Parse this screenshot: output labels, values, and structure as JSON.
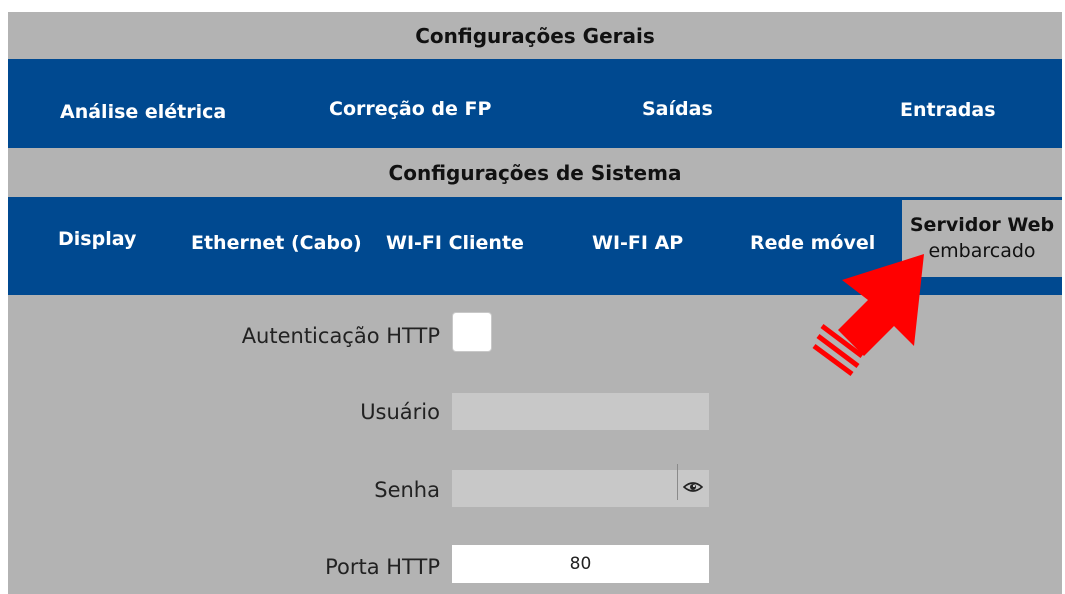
{
  "general": {
    "title": "Configurações Gerais",
    "tabs": [
      {
        "label": "Análise elétrica"
      },
      {
        "label": "Correção de FP"
      },
      {
        "label": "Saídas"
      },
      {
        "label": "Entradas"
      }
    ]
  },
  "system": {
    "title": "Configurações de Sistema",
    "tabs": [
      {
        "label": "Display"
      },
      {
        "label": "Ethernet (Cabo)"
      },
      {
        "label": "WI-FI Cliente"
      },
      {
        "label": "WI-FI AP"
      },
      {
        "label": "Rede móvel"
      },
      {
        "label_line1": "Servidor Web",
        "label_line2": "embarcado",
        "active": true
      }
    ]
  },
  "form": {
    "auth_label": "Autenticação HTTP",
    "auth_checked": false,
    "user_label": "Usuário",
    "user_value": "",
    "password_label": "Senha",
    "password_value": "",
    "port_label": "Porta HTTP",
    "port_value": "80"
  },
  "icons": {
    "password_toggle": "eye-icon",
    "annotation": "red-arrow-icon"
  },
  "colors": {
    "nav_blue": "#004990",
    "panel_gray": "#b3b3b3",
    "arrow_red": "#ff0000"
  }
}
